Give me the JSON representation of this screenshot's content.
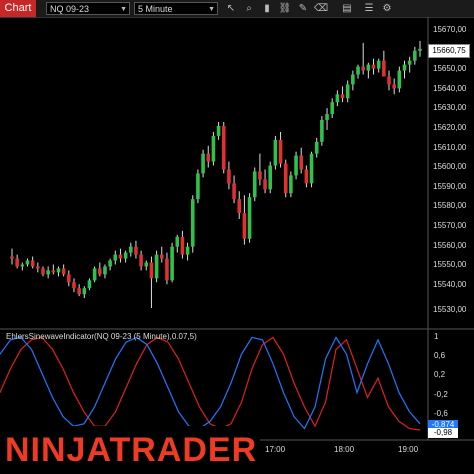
{
  "toolbar": {
    "chart_tab": "Chart",
    "instrument": "NQ 09-23",
    "interval": "5 Minute",
    "icons": [
      "cursor-icon",
      "magnify-icon",
      "bars-icon",
      "link-icon",
      "pencil-icon",
      "eraser-icon",
      "template-icon",
      "properties-icon",
      "settings-icon"
    ]
  },
  "price_axis": {
    "labels": [
      "15670,00",
      "15650,00",
      "15640,00",
      "15630,00",
      "15620,00",
      "15610,00",
      "15600,00",
      "15590,00",
      "15580,00",
      "15570,00",
      "15560,00",
      "15550,00",
      "15540,00",
      "15530,00"
    ],
    "current_price": "15660,75"
  },
  "indicator": {
    "label": "EhlersSinewaveIndicator(NQ 09-23 (5 Minute),0.07,5)",
    "axis_labels": [
      "1",
      "0,6",
      "0,2",
      "-0,2",
      "-0,6"
    ],
    "tag_blue": "-0,874",
    "tag_red": "-0,98",
    "color_blue": "#1e78ff",
    "color_red": "#e02020"
  },
  "time_axis": {
    "labels": [
      "17:00",
      "18:00",
      "19:00"
    ]
  },
  "logo": {
    "text": "NINJATRADER",
    "color": "#ef3b24"
  },
  "candles": [
    [
      15556,
      15560,
      15552,
      15555
    ],
    [
      15555,
      15557,
      15550,
      15551
    ],
    [
      15551,
      15553,
      15549,
      15552
    ],
    [
      15552,
      15555,
      15551,
      15554
    ],
    [
      15554,
      15556,
      15550,
      15551
    ],
    [
      15551,
      15553,
      15548,
      15550
    ],
    [
      15550,
      15551,
      15546,
      15547
    ],
    [
      15547,
      15551,
      15545,
      15549
    ],
    [
      15549,
      15552,
      15547,
      15548
    ],
    [
      15548,
      15551,
      15546,
      15550
    ],
    [
      15550,
      15552,
      15546,
      15547
    ],
    [
      15547,
      15549,
      15541,
      15543
    ],
    [
      15543,
      15545,
      15538,
      15540
    ],
    [
      15540,
      15542,
      15536,
      15537
    ],
    [
      15537,
      15541,
      15535,
      15540
    ],
    [
      15540,
      15545,
      15539,
      15544
    ],
    [
      15544,
      15551,
      15543,
      15550
    ],
    [
      15550,
      15553,
      15546,
      15547
    ],
    [
      15547,
      15552,
      15545,
      15551
    ],
    [
      15551,
      15555,
      15549,
      15554
    ],
    [
      15554,
      15559,
      15552,
      15557
    ],
    [
      15557,
      15560,
      15553,
      15555
    ],
    [
      15555,
      15559,
      15553,
      15558
    ],
    [
      15558,
      15563,
      15556,
      15561
    ],
    [
      15561,
      15564,
      15555,
      15557
    ],
    [
      15557,
      15559,
      15549,
      15551
    ],
    [
      15551,
      15554,
      15549,
      15553
    ],
    [
      15553,
      15556,
      15530,
      15545
    ],
    [
      15545,
      15559,
      15543,
      15557
    ],
    [
      15557,
      15561,
      15553,
      15555
    ],
    [
      15555,
      15558,
      15542,
      15544
    ],
    [
      15544,
      15563,
      15543,
      15561
    ],
    [
      15561,
      15567,
      15558,
      15566
    ],
    [
      15566,
      15569,
      15555,
      15557
    ],
    [
      15557,
      15563,
      15554,
      15561
    ],
    [
      15561,
      15587,
      15558,
      15585
    ],
    [
      15585,
      15600,
      15583,
      15598
    ],
    [
      15598,
      15610,
      15596,
      15608
    ],
    [
      15608,
      15612,
      15601,
      15604
    ],
    [
      15604,
      15619,
      15602,
      15617
    ],
    [
      15617,
      15624,
      15615,
      15622
    ],
    [
      15622,
      15624,
      15598,
      15600
    ],
    [
      15600,
      15604,
      15590,
      15593
    ],
    [
      15593,
      15597,
      15583,
      15585
    ],
    [
      15585,
      15589,
      15575,
      15578
    ],
    [
      15578,
      15587,
      15562,
      15565
    ],
    [
      15565,
      15588,
      15563,
      15586
    ],
    [
      15586,
      15601,
      15584,
      15599
    ],
    [
      15599,
      15608,
      15592,
      15595
    ],
    [
      15595,
      15600,
      15588,
      15590
    ],
    [
      15590,
      15604,
      15588,
      15602
    ],
    [
      15602,
      15617,
      15600,
      15615
    ],
    [
      15615,
      15619,
      15601,
      15603
    ],
    [
      15603,
      15605,
      15586,
      15588
    ],
    [
      15588,
      15599,
      15586,
      15597
    ],
    [
      15597,
      15609,
      15595,
      15607
    ],
    [
      15607,
      15611,
      15598,
      15600
    ],
    [
      15600,
      15602,
      15591,
      15593
    ],
    [
      15593,
      15609,
      15591,
      15608
    ],
    [
      15608,
      15616,
      15606,
      15614
    ],
    [
      15614,
      15627,
      15612,
      15625
    ],
    [
      15625,
      15631,
      15620,
      15628
    ],
    [
      15628,
      15636,
      15626,
      15634
    ],
    [
      15634,
      15640,
      15632,
      15638
    ],
    [
      15638,
      15642,
      15634,
      15636
    ],
    [
      15636,
      15645,
      15634,
      15643
    ],
    [
      15643,
      15650,
      15640,
      15648
    ],
    [
      15648,
      15653,
      15646,
      15652
    ],
    [
      15652,
      15664,
      15648,
      15650
    ],
    [
      15650,
      15654,
      15646,
      15653
    ],
    [
      15653,
      15656,
      15648,
      15651
    ],
    [
      15651,
      15656,
      15649,
      15655
    ],
    [
      15655,
      15660,
      15652,
      15647
    ],
    [
      15647,
      15650,
      15640,
      15643
    ],
    [
      15643,
      15646,
      15638,
      15641
    ],
    [
      15641,
      15652,
      15639,
      15650
    ],
    [
      15650,
      15655,
      15646,
      15653
    ],
    [
      15653,
      15657,
      15649,
      15655
    ],
    [
      15655,
      15662,
      15653,
      15660
    ],
    [
      15660,
      15665,
      15657,
      15661
    ]
  ],
  "sine_blue": [
    0.6,
    0.9,
    0.95,
    0.7,
    0.2,
    -0.3,
    -0.7,
    -0.9,
    -0.85,
    -0.5,
    0.0,
    0.5,
    0.85,
    0.95,
    0.8,
    0.4,
    -0.1,
    -0.6,
    -0.9,
    -0.95,
    -0.8,
    -0.5,
    0.0,
    0.6,
    0.95,
    0.9,
    0.4,
    -0.2,
    -0.7,
    -0.95,
    -0.5,
    0.5,
    0.95,
    0.6,
    -0.2,
    0.4,
    0.9,
    0.4,
    -0.2,
    -0.6,
    -0.85
  ],
  "sine_red": [
    -0.2,
    0.3,
    0.7,
    0.9,
    0.95,
    0.7,
    0.3,
    -0.2,
    -0.6,
    -0.9,
    -0.9,
    -0.6,
    -0.1,
    0.4,
    0.8,
    0.95,
    0.85,
    0.5,
    0.0,
    -0.5,
    -0.85,
    -0.95,
    -0.85,
    -0.4,
    0.3,
    0.8,
    0.95,
    0.6,
    0.0,
    -0.5,
    -0.9,
    -0.4,
    0.7,
    0.9,
    0.3,
    -0.3,
    0.1,
    -0.5,
    -0.8,
    -0.95,
    -0.98
  ]
}
